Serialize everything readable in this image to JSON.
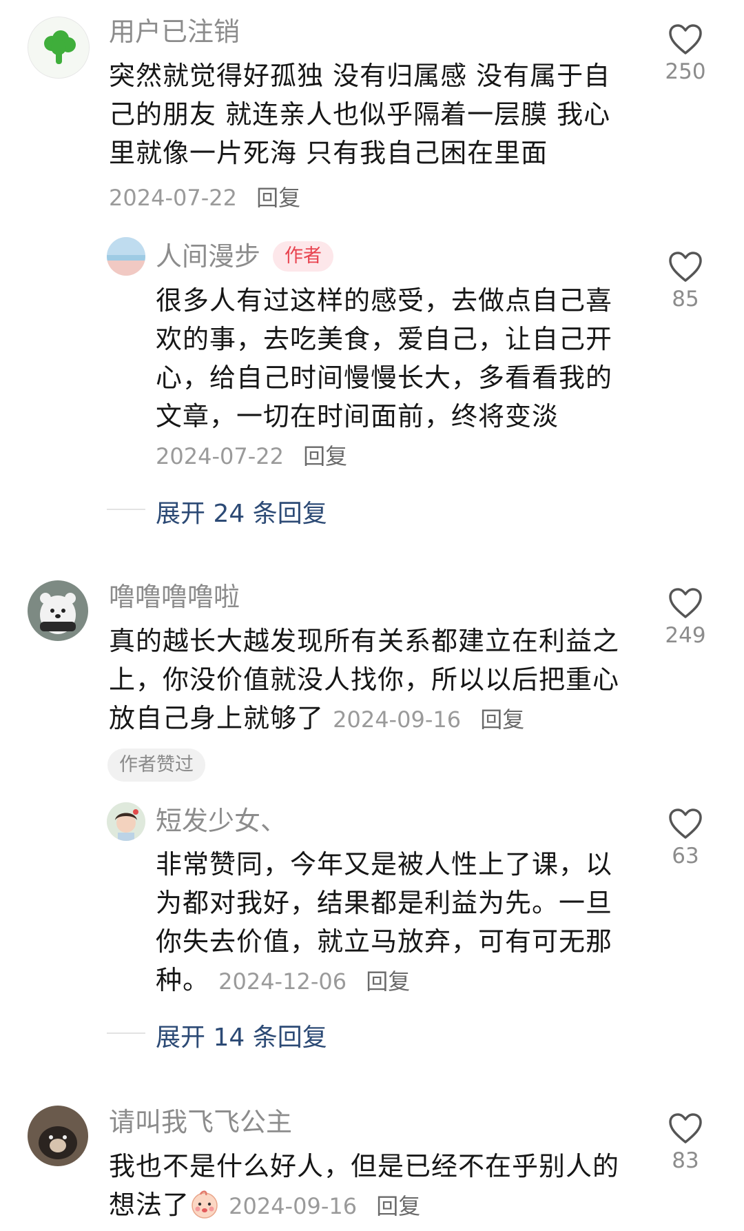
{
  "comments": [
    {
      "user": "用户已注销",
      "text": "突然就觉得好孤独 没有归属感 没有属于自己的朋友 就连亲人也似乎隔着一层膜 我心里就像一片死海 只有我自己困在里面",
      "date": "2024-07-22",
      "reply_label": "回复",
      "likes": "250",
      "avatar_icon": "broccoli-icon",
      "reply": {
        "user": "人间漫步",
        "author_tag": "作者",
        "text": "很多人有过这样的感受，去做点自己喜欢的事，去吃美食，爱自己，让自己开心，给自己时间慢慢长大，多看看我的文章，一切在时间面前，终将变淡",
        "date": "2024-07-22",
        "reply_label": "回复",
        "likes": "85"
      },
      "expand": "展开 24 条回复"
    },
    {
      "user": "噜噜噜噜啦",
      "text": "真的越长大越发现所有关系都建立在利益之上，你没价值就没人找你，所以以后把重心放自己身上就够了",
      "date": "2024-09-16",
      "reply_label": "回复",
      "likes": "249",
      "author_liked": "作者赞过",
      "reply": {
        "user": "短发少女、",
        "text": "非常赞同，今年又是被人性上了课，以为都对我好，结果都是利益为先。一旦你失去价值，就立马放弃，可有可无那种。",
        "date": "2024-12-06",
        "reply_label": "回复",
        "likes": "63"
      },
      "expand": "展开 14 条回复"
    },
    {
      "user": "请叫我飞飞公主",
      "text": "我也不是什么好人，但是已经不在乎别人的想法了",
      "date": "2024-09-16",
      "reply_label": "回复",
      "likes": "83",
      "emoji": "baby-face-emoji"
    }
  ],
  "colors": {
    "accent_link": "#2c4a75",
    "author_tag_bg": "#fde7ea",
    "author_tag_text": "#e8434f"
  }
}
